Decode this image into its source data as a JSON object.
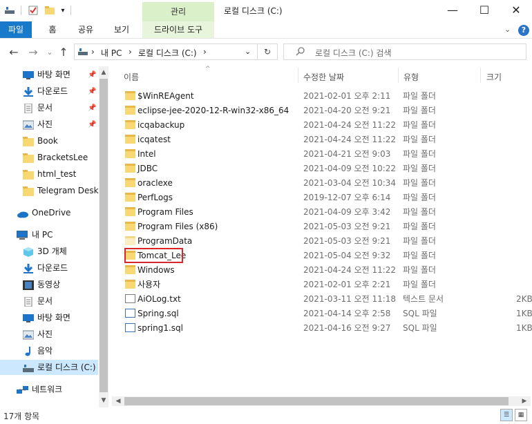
{
  "window": {
    "title": "로컬 디스크 (C:)",
    "context_tab": "관리",
    "controls": {
      "minimize": "—",
      "maximize": "☐",
      "close": "✕"
    }
  },
  "quick_access": {
    "dropdown": "▾"
  },
  "ribbon": {
    "tabs": [
      {
        "label": "파일"
      },
      {
        "label": "홈"
      },
      {
        "label": "공유"
      },
      {
        "label": "보기"
      },
      {
        "label": "드라이브 도구"
      }
    ],
    "help": "?",
    "collapse": "⌄"
  },
  "address": {
    "back": "←",
    "forward": "→",
    "recent": "⌄",
    "up": "↑",
    "breadcrumb": [
      "내 PC",
      "로컬 디스크 (C:)"
    ],
    "separator": "›",
    "dropdown": "⌄",
    "refresh": "↻",
    "search_placeholder": "로컬 디스크 (C:) 검색"
  },
  "nav": {
    "items": [
      {
        "label": "바탕 화면",
        "icon": "desktop-icon",
        "pinned": true
      },
      {
        "label": "다운로드",
        "icon": "download-icon",
        "pinned": true
      },
      {
        "label": "문서",
        "icon": "document-icon",
        "pinned": true
      },
      {
        "label": "사진",
        "icon": "picture-icon",
        "pinned": true
      },
      {
        "label": "Book",
        "icon": "folder-icon"
      },
      {
        "label": "BracketsLee",
        "icon": "folder-icon"
      },
      {
        "label": "html_test",
        "icon": "folder-icon"
      },
      {
        "label": "Telegram Desktop",
        "icon": "folder-icon"
      },
      {
        "label": "OneDrive",
        "icon": "cloud-icon"
      },
      {
        "label": "내 PC",
        "icon": "pc-icon"
      },
      {
        "label": "3D 개체",
        "icon": "cube-icon"
      },
      {
        "label": "다운로드",
        "icon": "download-icon"
      },
      {
        "label": "동영상",
        "icon": "video-icon"
      },
      {
        "label": "문서",
        "icon": "document-icon"
      },
      {
        "label": "바탕 화면",
        "icon": "desktop-icon"
      },
      {
        "label": "사진",
        "icon": "picture-icon"
      },
      {
        "label": "음악",
        "icon": "music-icon"
      },
      {
        "label": "로컬 디스크 (C:)",
        "icon": "drive-icon",
        "selected": true
      },
      {
        "label": "네트워크",
        "icon": "network-icon"
      }
    ]
  },
  "columns": {
    "name": "이름",
    "date": "수정한 날짜",
    "type": "유형",
    "size": "크기"
  },
  "files": [
    {
      "name": "$WinREAgent",
      "date": "2021-02-01 오후 2:11",
      "type": "파일 폴더",
      "size": "",
      "icon": "folder-icon"
    },
    {
      "name": "eclipse-jee-2020-12-R-win32-x86_64",
      "date": "2021-04-20 오전 9:21",
      "type": "파일 폴더",
      "size": "",
      "icon": "folder-icon"
    },
    {
      "name": "icqabackup",
      "date": "2021-04-24 오전 11:22",
      "type": "파일 폴더",
      "size": "",
      "icon": "folder-icon"
    },
    {
      "name": "icqatest",
      "date": "2021-04-24 오전 11:22",
      "type": "파일 폴더",
      "size": "",
      "icon": "folder-icon"
    },
    {
      "name": "Intel",
      "date": "2021-04-21 오전 9:03",
      "type": "파일 폴더",
      "size": "",
      "icon": "folder-icon"
    },
    {
      "name": "JDBC",
      "date": "2021-04-09 오전 10:22",
      "type": "파일 폴더",
      "size": "",
      "icon": "folder-icon"
    },
    {
      "name": "oraclexe",
      "date": "2021-03-04 오전 10:34",
      "type": "파일 폴더",
      "size": "",
      "icon": "folder-icon"
    },
    {
      "name": "PerfLogs",
      "date": "2019-12-07 오후 6:14",
      "type": "파일 폴더",
      "size": "",
      "icon": "folder-icon"
    },
    {
      "name": "Program Files",
      "date": "2021-04-09 오후 3:42",
      "type": "파일 폴더",
      "size": "",
      "icon": "folder-icon"
    },
    {
      "name": "Program Files (x86)",
      "date": "2021-05-03 오전 9:21",
      "type": "파일 폴더",
      "size": "",
      "icon": "folder-icon"
    },
    {
      "name": "ProgramData",
      "date": "2021-05-03 오전 9:21",
      "type": "파일 폴더",
      "size": "",
      "icon": "folder-light-icon"
    },
    {
      "name": "Tomcat_Lee",
      "date": "2021-05-04 오전 9:32",
      "type": "파일 폴더",
      "size": "",
      "icon": "folder-icon",
      "highlighted": true
    },
    {
      "name": "Windows",
      "date": "2021-04-24 오전 11:22",
      "type": "파일 폴더",
      "size": "",
      "icon": "folder-icon"
    },
    {
      "name": "사용자",
      "date": "2021-02-01 오후 2:21",
      "type": "파일 폴더",
      "size": "",
      "icon": "folder-icon"
    },
    {
      "name": "AiOLog.txt",
      "date": "2021-03-11 오전 11:18",
      "type": "텍스트 문서",
      "size": "2KB",
      "icon": "text-file-icon"
    },
    {
      "name": "Spring.sql",
      "date": "2021-04-14 오후 2:58",
      "type": "SQL 파일",
      "size": "1KB",
      "icon": "sql-file-icon"
    },
    {
      "name": "spring1.sql",
      "date": "2021-04-16 오전 9:27",
      "type": "SQL 파일",
      "size": "1KB",
      "icon": "sql-file-icon"
    }
  ],
  "status": {
    "count": "17개 항목"
  },
  "colors": {
    "accent": "#1979ca",
    "selection": "#cce8ff",
    "highlight_box": "#d9262b",
    "context_tab": "#d9f0c8"
  }
}
